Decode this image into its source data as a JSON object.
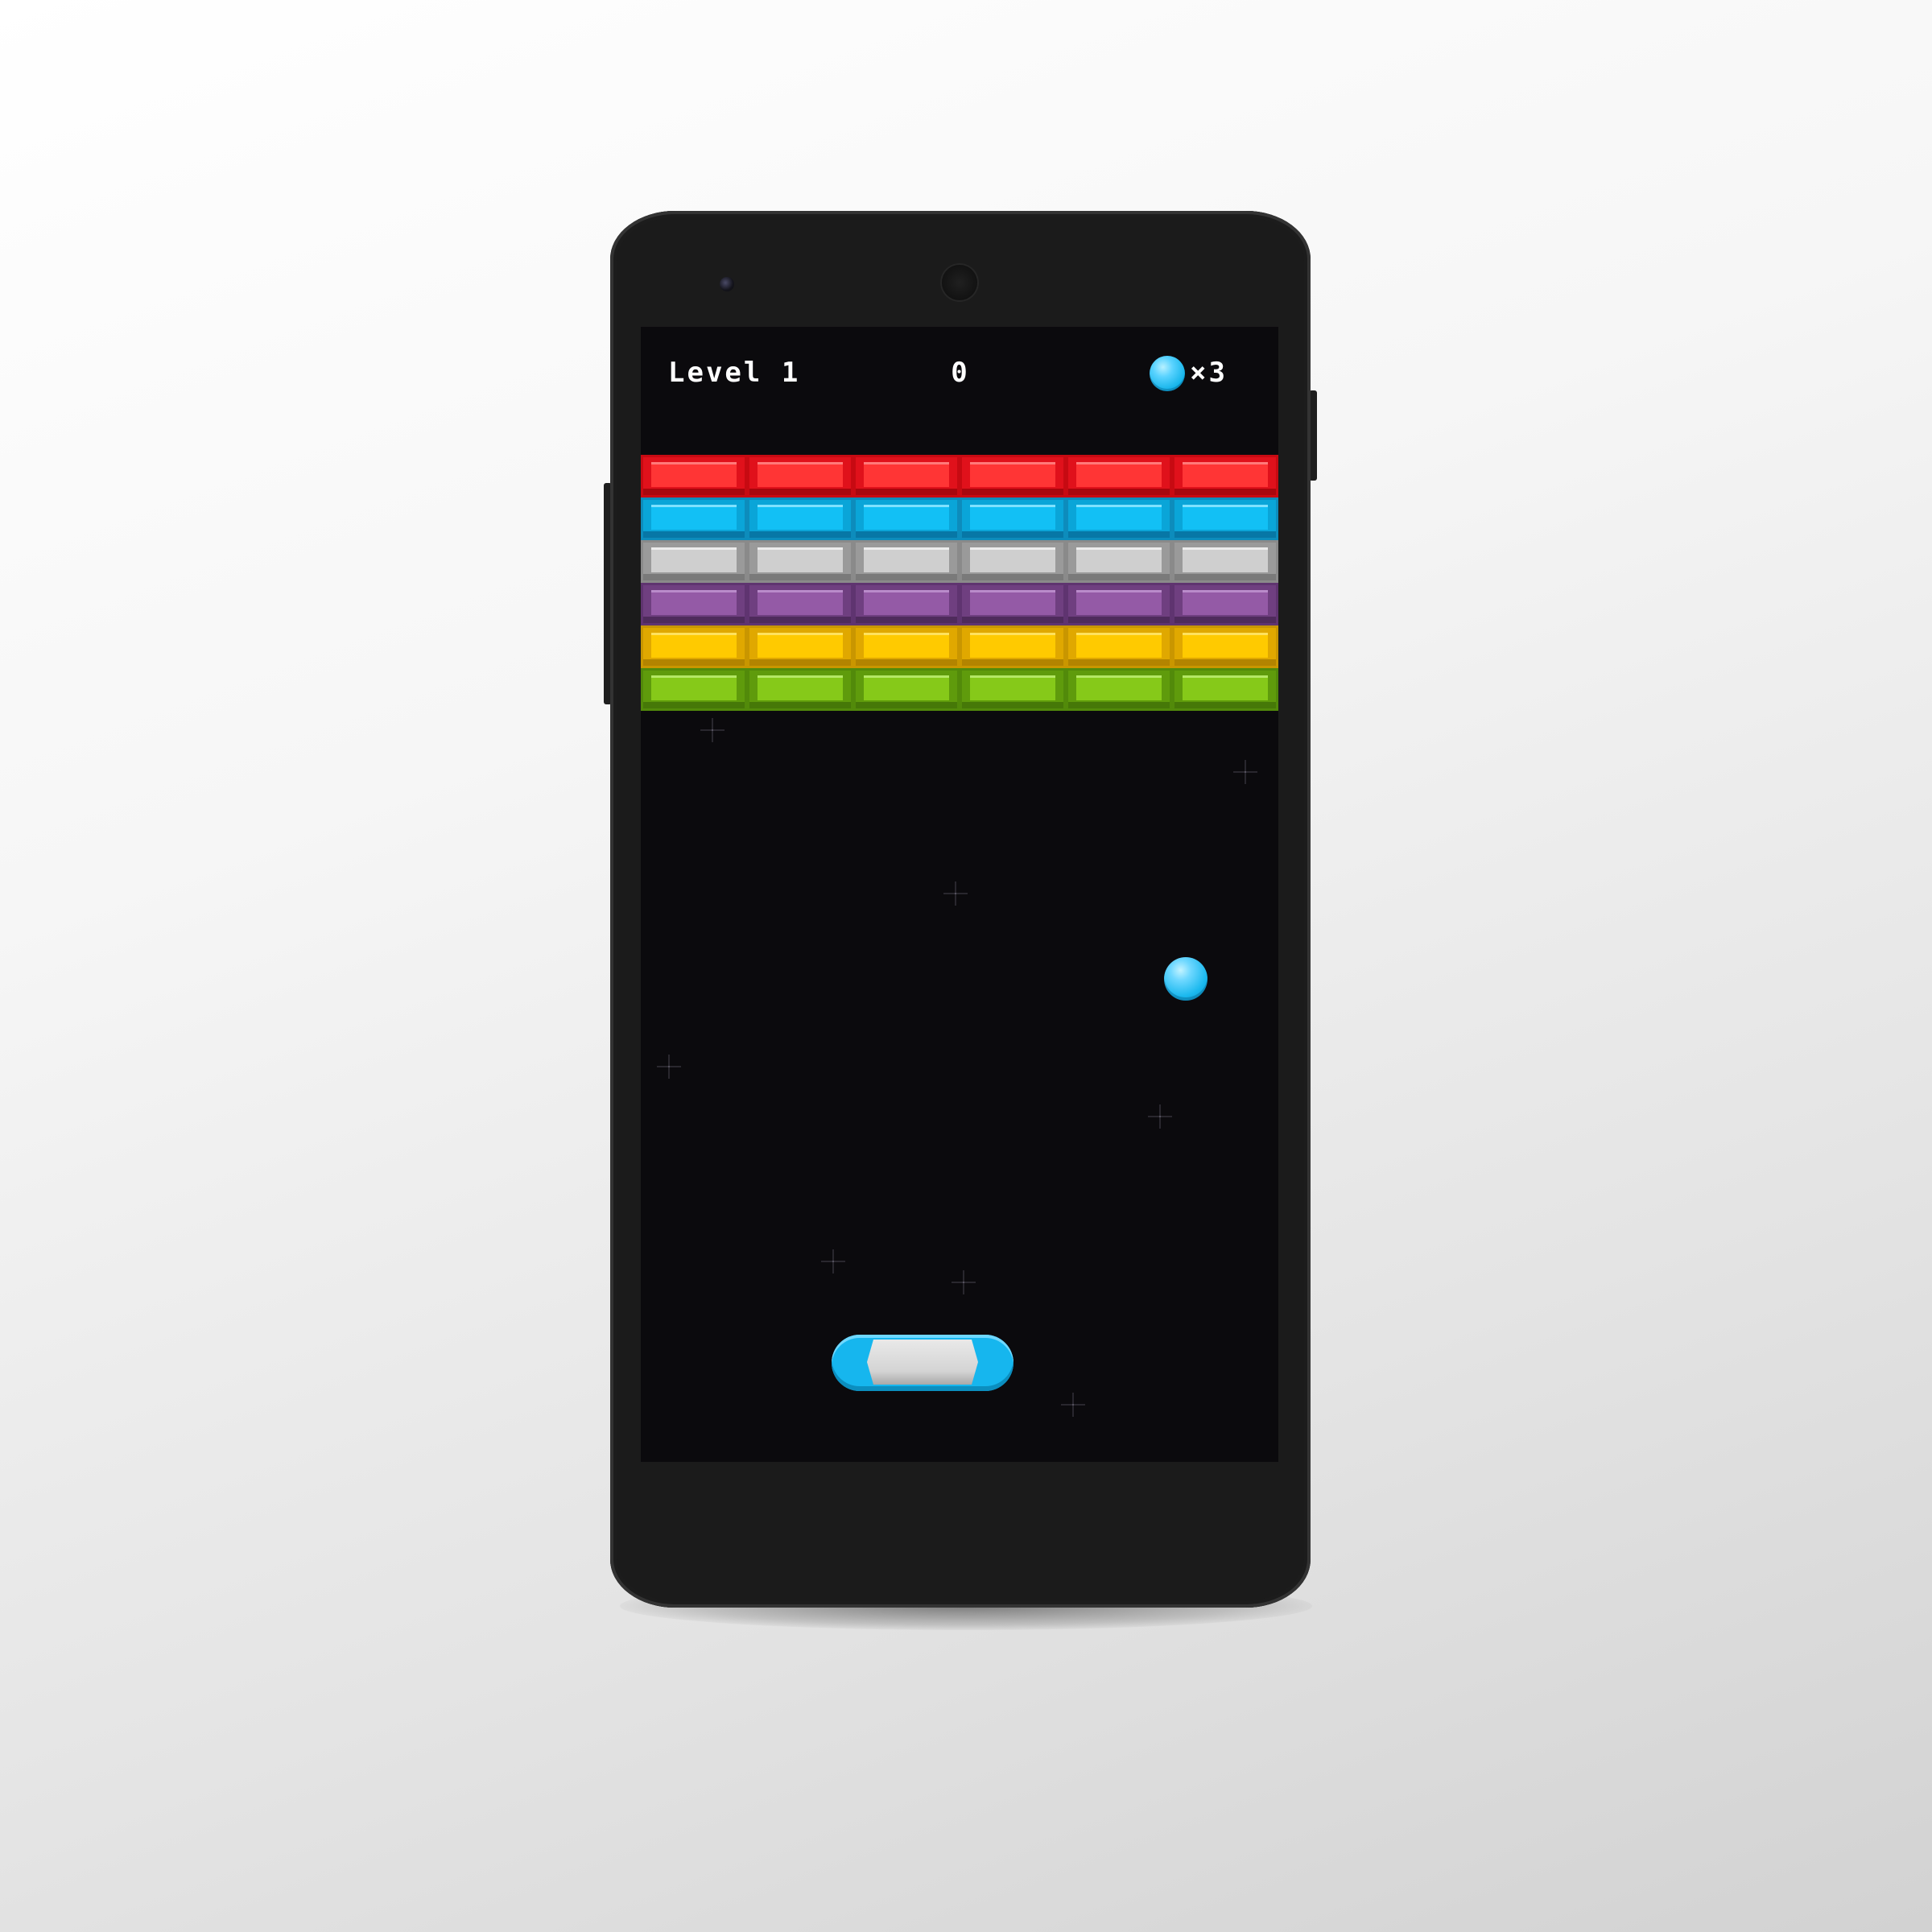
{
  "hud": {
    "level_label": "Level 1",
    "score": "0",
    "lives": "×3",
    "lives_icon": "ball-icon"
  },
  "bricks": {
    "columns": 6,
    "rows": [
      {
        "color": "red",
        "base": "#e0111b",
        "face": "#ff3535",
        "light": "#ff7a7a",
        "dark": "#a8070e",
        "edge": "#c70a12"
      },
      {
        "color": "blue",
        "base": "#0aa5d8",
        "face": "#12c0f5",
        "light": "#7fe1ff",
        "dark": "#0777a6",
        "edge": "#0d8cbc"
      },
      {
        "color": "gray",
        "base": "#9a9a9a",
        "face": "#cfcfcf",
        "light": "#ececec",
        "dark": "#7a7a7a",
        "edge": "#8a8a8a"
      },
      {
        "color": "purple",
        "base": "#6f3f80",
        "face": "#945aa6",
        "light": "#b98bca",
        "dark": "#4f2b5c",
        "edge": "#5f3470"
      },
      {
        "color": "yellow",
        "base": "#e0a800",
        "face": "#ffca00",
        "light": "#ffe15e",
        "dark": "#b38400",
        "edge": "#c99600"
      },
      {
        "color": "green",
        "base": "#5f9b0c",
        "face": "#86c919",
        "light": "#b4e765",
        "dark": "#467808",
        "edge": "#528a0a"
      }
    ]
  },
  "colors": {
    "screen_background": "#0b0a0d",
    "ball": "#1ab8ee",
    "paddle_caps": "#16b6ee",
    "paddle_body": "#d4d4d4"
  }
}
